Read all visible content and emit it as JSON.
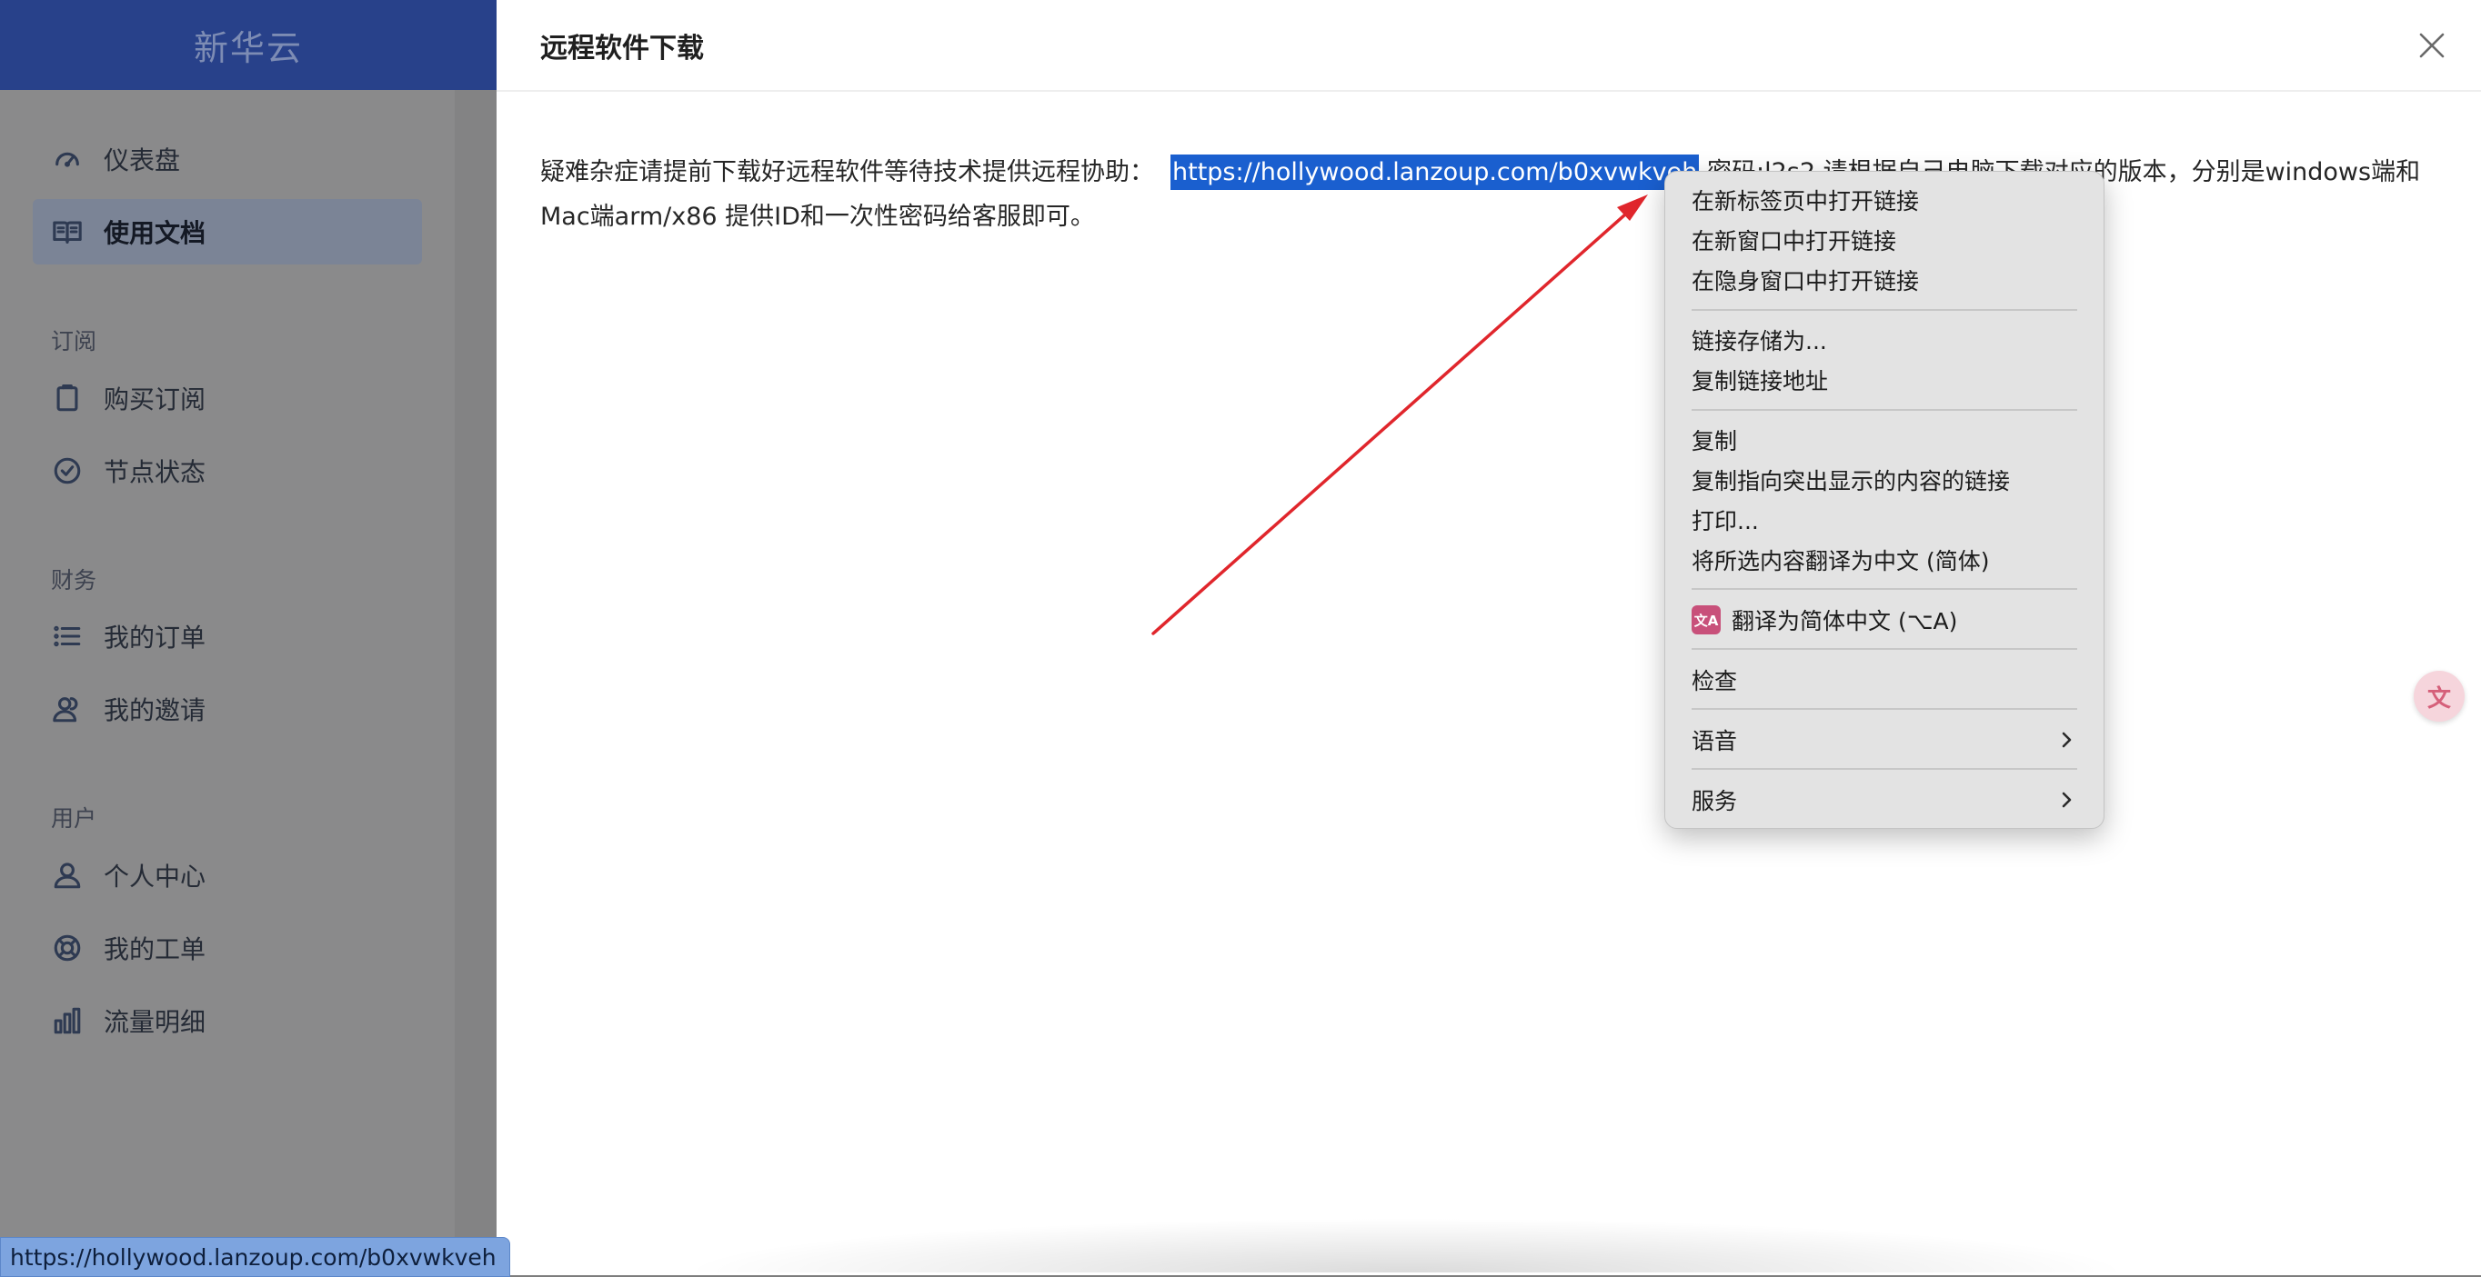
{
  "sidebar": {
    "brand": "新华云",
    "items": [
      {
        "label": "仪表盘"
      },
      {
        "label": "使用文档"
      },
      {
        "label": "购买订阅"
      },
      {
        "label": "节点状态"
      },
      {
        "label": "我的订单"
      },
      {
        "label": "我的邀请"
      },
      {
        "label": "个人中心"
      },
      {
        "label": "我的工单"
      },
      {
        "label": "流量明细"
      }
    ],
    "sections": [
      "订阅",
      "财务",
      "用户"
    ]
  },
  "modal": {
    "title": "远程软件下载",
    "body_prefix": "疑难杂症请提前下载好远程软件等待技术提供远程协助：",
    "link": "https://hollywood.lanzoup.com/b0xvwkveh",
    "body_suffix": " 密码:l2s2  请根据自己电脑下载对应的版本，分别是windows端和Mac端arm/x86 提供ID和一次性密码给客服即可。"
  },
  "context_menu": {
    "open_new_tab": "在新标签页中打开链接",
    "open_new_window": "在新窗口中打开链接",
    "open_incognito": "在隐身窗口中打开链接",
    "save_link_as": "链接存储为...",
    "copy_link_address": "复制链接地址",
    "copy": "复制",
    "copy_link_to_highlight": "复制指向突出显示的内容的链接",
    "print": "打印...",
    "translate_selection": "将所选内容翻译为中文 (简体)",
    "translate_page": "翻译为简体中文 (⌥A)",
    "inspect": "检查",
    "speech": "语音",
    "services": "服务"
  },
  "status_bar": {
    "url": "https://hollywood.lanzoup.com/b0xvwkveh"
  },
  "icons": {
    "translate_fab": "translate-icon",
    "close": "close-icon"
  },
  "colors": {
    "brand_header": "#28418a",
    "selection": "#1a5fcf",
    "annotation_arrow": "#e0262c"
  }
}
